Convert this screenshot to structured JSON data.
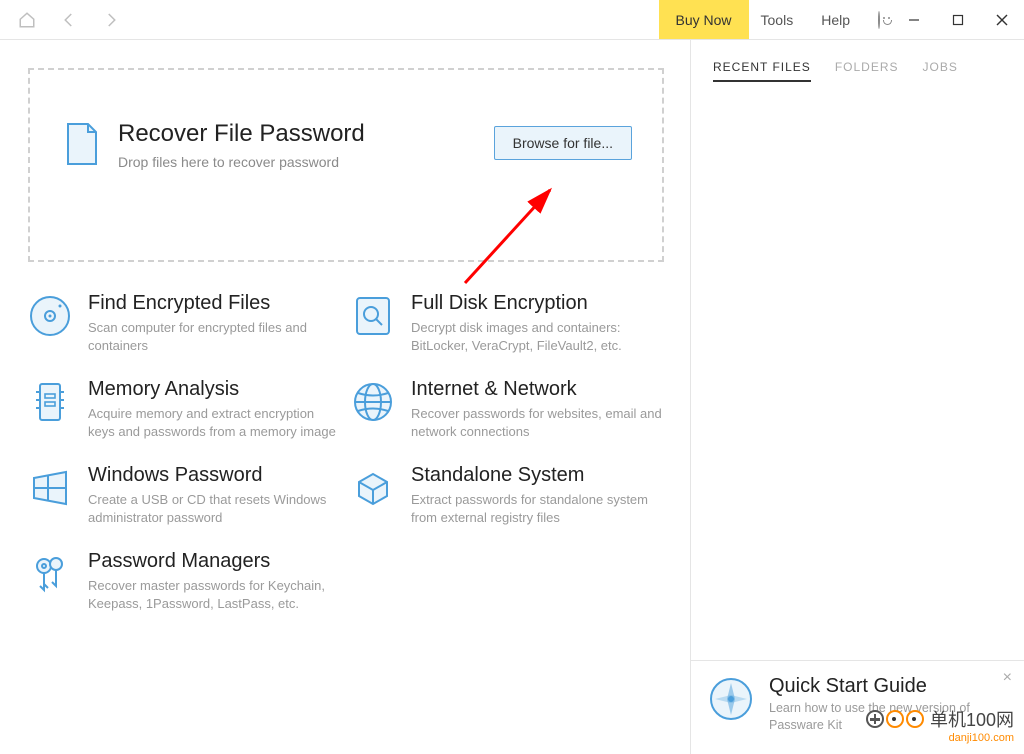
{
  "titlebar": {
    "buy_now": "Buy Now",
    "tools": "Tools",
    "help": "Help"
  },
  "dropzone": {
    "title": "Recover File Password",
    "subtitle": "Drop files here to recover password",
    "browse": "Browse for file..."
  },
  "features": [
    {
      "title": "Find Encrypted Files",
      "desc": "Scan computer for encrypted files and containers"
    },
    {
      "title": "Full Disk Encryption",
      "desc": "Decrypt disk images and containers: BitLocker, VeraCrypt, FileVault2, etc."
    },
    {
      "title": "Memory Analysis",
      "desc": "Acquire memory and extract encryption keys and passwords from a memory image"
    },
    {
      "title": "Internet & Network",
      "desc": "Recover passwords for websites, email and network connections"
    },
    {
      "title": "Windows Password",
      "desc": "Create a USB or CD that resets Windows administrator password"
    },
    {
      "title": "Standalone System",
      "desc": "Extract passwords for standalone system from external registry files"
    },
    {
      "title": "Password Managers",
      "desc": "Recover master passwords for Keychain, Keepass, 1Password, LastPass, etc."
    }
  ],
  "tabs": {
    "recent": "RECENT FILES",
    "folders": "FOLDERS",
    "jobs": "JOBS"
  },
  "qsg": {
    "title": "Quick Start Guide",
    "desc": "Learn how to use the new version of Passware Kit"
  },
  "watermark": {
    "line1": "单机100网",
    "line2": "danji100.com"
  }
}
